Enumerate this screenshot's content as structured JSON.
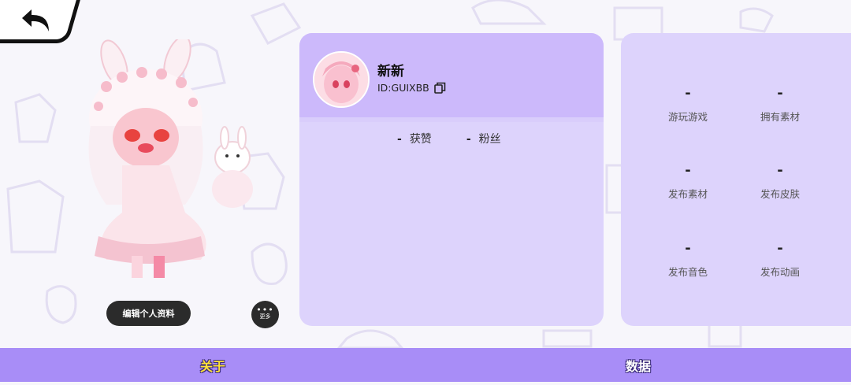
{
  "profile": {
    "username": "新新",
    "user_id": "ID:GUIXBB",
    "stats": [
      {
        "value": "-",
        "label": "获赞"
      },
      {
        "value": "-",
        "label": "粉丝"
      }
    ]
  },
  "actions": {
    "edit_profile_label": "编辑个人资料",
    "more_dots": "•••",
    "more_label": "更多"
  },
  "data_panel": {
    "items": [
      {
        "value": "-",
        "label": "游玩游戏"
      },
      {
        "value": "-",
        "label": "拥有素材"
      },
      {
        "value": "-",
        "label": "发布素材"
      },
      {
        "value": "-",
        "label": "发布皮肤"
      },
      {
        "value": "-",
        "label": "发布音色"
      },
      {
        "value": "-",
        "label": "发布动画"
      }
    ]
  },
  "tabs": {
    "about": "关于",
    "data": "数据"
  },
  "icons": {
    "back": "back-arrow-icon",
    "copy": "copy-icon",
    "more": "more-dots-icon"
  },
  "colors": {
    "tab_bar": "#a88df7",
    "card": "#ddd3fc",
    "card_header": "#ccb9fb",
    "active_tab": "#ffe238"
  }
}
